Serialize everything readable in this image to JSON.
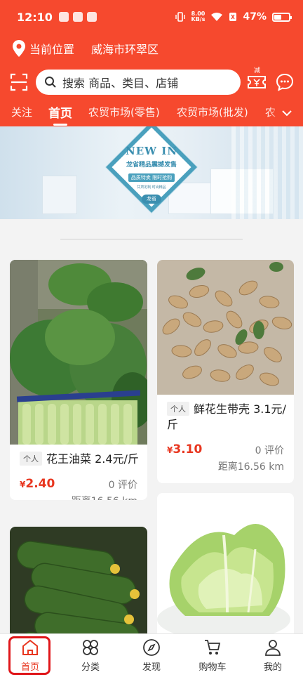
{
  "status_bar": {
    "time": "12:10",
    "net_speed_value": "8.00",
    "net_speed_unit": "KB/s",
    "battery": "47%"
  },
  "location": {
    "label": "当前位置",
    "city": "威海市环翠区",
    "icon": "location-pin-icon"
  },
  "search": {
    "placeholder": "搜索 商品、类目、店铺",
    "coupon_badge": "减"
  },
  "tabs": [
    {
      "label": "关注",
      "active": false
    },
    {
      "label": "首页",
      "active": true
    },
    {
      "label": "农贸市场(零售)",
      "active": false
    },
    {
      "label": "农贸市场(批发)",
      "active": false
    },
    {
      "label": "农",
      "active": false
    }
  ],
  "banner": {
    "heading": "NEW IN",
    "title": "龙省精品震撼发售",
    "subtitle": "品质特卖  限时抢购",
    "small_text": "甘肃定制 时尚精品",
    "seal": "龙省"
  },
  "products": [
    {
      "tag": "个人",
      "name": "花王油菜 2.4元/斤",
      "price_symbol": "¥",
      "price": "2.40",
      "reviews": "0 评价",
      "distance": "距离16.56 km"
    },
    {
      "tag": "个人",
      "name": "鲜花生带壳 3.1元/斤",
      "price_symbol": "¥",
      "price": "3.10",
      "reviews": "0 评价",
      "distance": "距离16.56 km"
    }
  ],
  "bottom_nav": [
    {
      "label": "首页",
      "icon": "home-icon",
      "active": true
    },
    {
      "label": "分类",
      "icon": "category-icon",
      "active": false
    },
    {
      "label": "发现",
      "icon": "compass-icon",
      "active": false
    },
    {
      "label": "购物车",
      "icon": "cart-icon",
      "active": false
    },
    {
      "label": "我的",
      "icon": "user-icon",
      "active": false
    }
  ],
  "colors": {
    "brand_red": "#f6492e",
    "price_red": "#e8361f",
    "banner_teal": "#4aa0bd"
  }
}
